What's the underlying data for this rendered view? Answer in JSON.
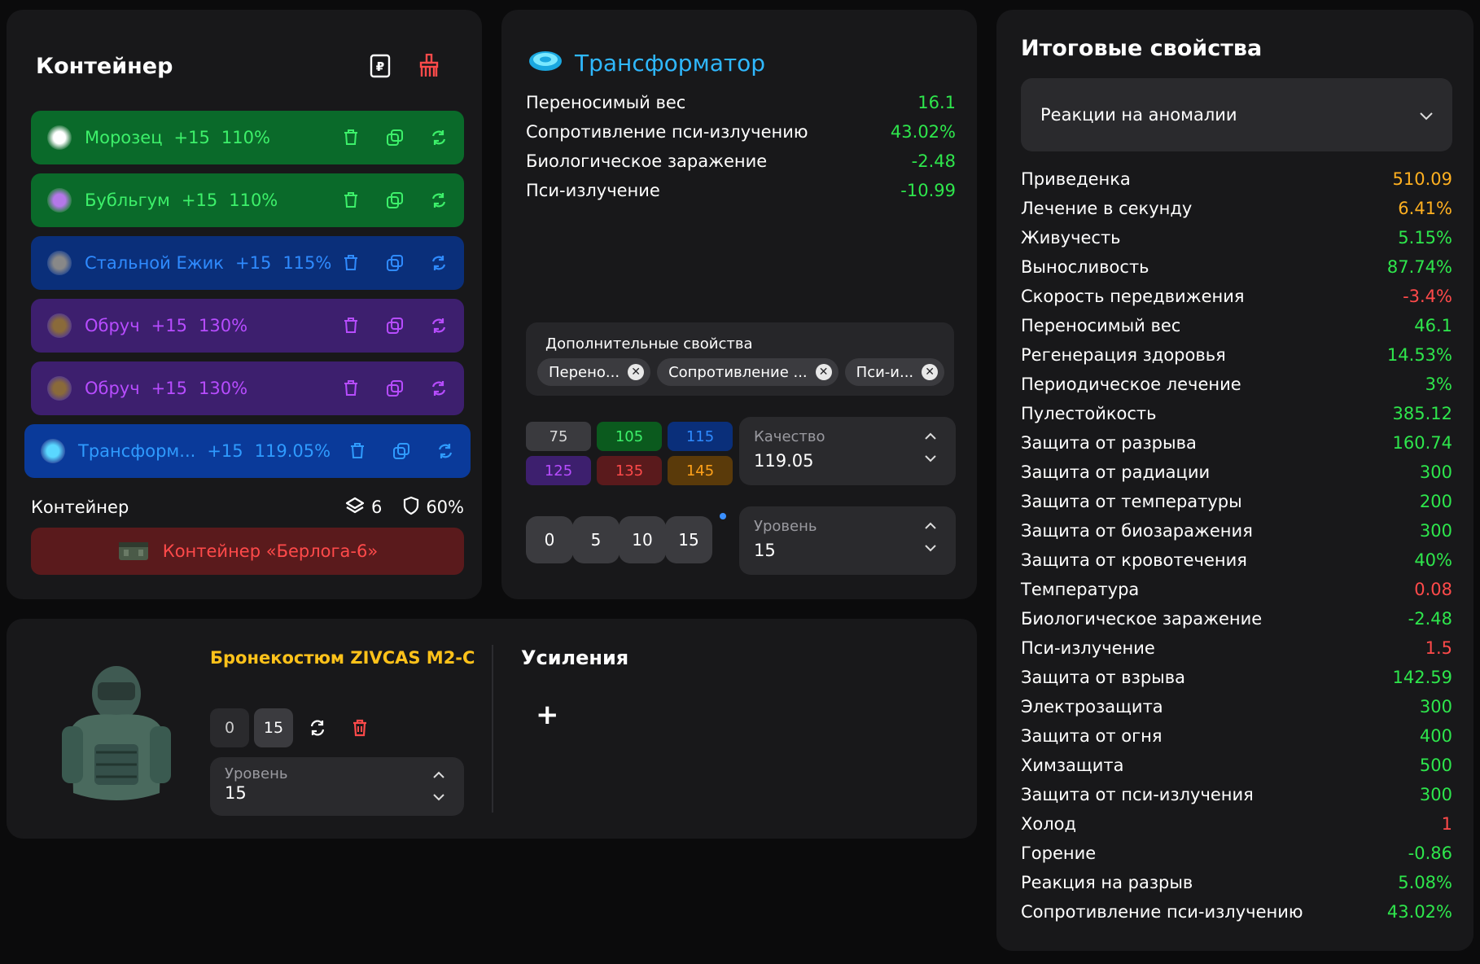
{
  "container": {
    "title": "Контейнер",
    "slots": [
      {
        "name": "Морозец",
        "level": "+15",
        "quality": "110%",
        "bg": "#0a6a2a",
        "fg": "#3df06a",
        "icon_color": "#ffffff"
      },
      {
        "name": "Бубльгум",
        "level": "+15",
        "quality": "110%",
        "bg": "#0a6a2a",
        "fg": "#3df06a",
        "icon_color": "#b478e8"
      },
      {
        "name": "Стальной Ежик",
        "level": "+15",
        "quality": "115%",
        "bg": "#0a2f7a",
        "fg": "#2f8bff",
        "icon_color": "#888888"
      },
      {
        "name": "Обруч",
        "level": "+15",
        "quality": "130%",
        "bg": "#3d1f6e",
        "fg": "#b74cff",
        "icon_color": "#8a6a3a"
      },
      {
        "name": "Обруч",
        "level": "+15",
        "quality": "130%",
        "bg": "#3d1f6e",
        "fg": "#b74cff",
        "icon_color": "#8a6a3a"
      },
      {
        "name": "Трансформ...",
        "level": "+15",
        "quality": "119.05%",
        "bg": "#0a3a9a",
        "fg": "#2f9bff",
        "icon_color": "#5ad8ff"
      }
    ],
    "footer_label": "Контейнер",
    "slots_count": "6",
    "protection": "60%",
    "container_button": "Контейнер «Берлога-6»"
  },
  "transformer": {
    "title": "Трансформатор",
    "props": [
      {
        "label": "Переносимый вес",
        "value": "16.1"
      },
      {
        "label": "Сопротивление пси-излучению",
        "value": "43.02%"
      },
      {
        "label": "Биологическое заражение",
        "value": "-2.48"
      },
      {
        "label": "Пси-излучение",
        "value": "-10.99"
      }
    ],
    "additional_title": "Дополнительные свойства",
    "chips": [
      "Перено...",
      "Сопротивление ...",
      "Пси-и..."
    ],
    "quality_buttons": [
      {
        "label": "75",
        "bg": "#3a3a3e",
        "fg": "#d8d8d8"
      },
      {
        "label": "105",
        "bg": "#0b5a1e",
        "fg": "#3df06a"
      },
      {
        "label": "115",
        "bg": "#0a2f7a",
        "fg": "#2f8bff"
      },
      {
        "label": "125",
        "bg": "#3d1f6e",
        "fg": "#b74cff"
      },
      {
        "label": "135",
        "bg": "#5a1a1c",
        "fg": "#ff4a4a"
      },
      {
        "label": "145",
        "bg": "#5a3a0a",
        "fg": "#ffa21a"
      }
    ],
    "quality_label": "Качество",
    "quality_value": "119.05",
    "level_buttons": [
      "0",
      "5",
      "10",
      "15"
    ],
    "level_label": "Уровень",
    "level_value": "15"
  },
  "armor": {
    "name": "Бронекостюм ZIVCAS M2-C",
    "level_buttons": [
      "0",
      "15"
    ],
    "level_label": "Уровень",
    "level_value": "15",
    "upgrades_title": "Усиления",
    "add_label": "+"
  },
  "totals": {
    "title": "Итоговые свойства",
    "dropdown": "Реакции на аномалии",
    "rows": [
      {
        "label": "Приведенка",
        "value": "510.09",
        "color": "#ffb020"
      },
      {
        "label": "Лечение в секунду",
        "value": "6.41%",
        "color": "#ffb020"
      },
      {
        "label": "Живучесть",
        "value": "5.15%",
        "color": "#2ee64c"
      },
      {
        "label": "Выносливость",
        "value": "87.74%",
        "color": "#2ee64c"
      },
      {
        "label": "Скорость передвижения",
        "value": "-3.4%",
        "color": "#ff4a4a"
      },
      {
        "label": "Переносимый вес",
        "value": "46.1",
        "color": "#2ee64c"
      },
      {
        "label": "Регенерация здоровья",
        "value": "14.53%",
        "color": "#2ee64c"
      },
      {
        "label": "Периодическое лечение",
        "value": "3%",
        "color": "#2ee64c"
      },
      {
        "label": "Пулестойкость",
        "value": "385.12",
        "color": "#2ee64c"
      },
      {
        "label": "Защита от разрыва",
        "value": "160.74",
        "color": "#2ee64c"
      },
      {
        "label": "Защита от радиации",
        "value": "300",
        "color": "#2ee64c"
      },
      {
        "label": "Защита от температуры",
        "value": "200",
        "color": "#2ee64c"
      },
      {
        "label": "Защита от биозаражения",
        "value": "300",
        "color": "#2ee64c"
      },
      {
        "label": "Защита от кровотечения",
        "value": "40%",
        "color": "#2ee64c"
      },
      {
        "label": "Температура",
        "value": "0.08",
        "color": "#ff4a4a"
      },
      {
        "label": "Биологическое заражение",
        "value": "-2.48",
        "color": "#2ee64c"
      },
      {
        "label": "Пси-излучение",
        "value": "1.5",
        "color": "#ff4a4a"
      },
      {
        "label": "Защита от взрыва",
        "value": "142.59",
        "color": "#2ee64c"
      },
      {
        "label": "Электрозащита",
        "value": "300",
        "color": "#2ee64c"
      },
      {
        "label": "Защита от огня",
        "value": "400",
        "color": "#2ee64c"
      },
      {
        "label": "Химзащита",
        "value": "500",
        "color": "#2ee64c"
      },
      {
        "label": "Защита от пси-излучения",
        "value": "300",
        "color": "#2ee64c"
      },
      {
        "label": "Холод",
        "value": "1",
        "color": "#ff4a4a"
      },
      {
        "label": "Горение",
        "value": "-0.86",
        "color": "#2ee64c"
      },
      {
        "label": "Реакция на разрыв",
        "value": "5.08%",
        "color": "#2ee64c"
      },
      {
        "label": "Сопротивление пси-излучению",
        "value": "43.02%",
        "color": "#2ee64c"
      }
    ]
  }
}
